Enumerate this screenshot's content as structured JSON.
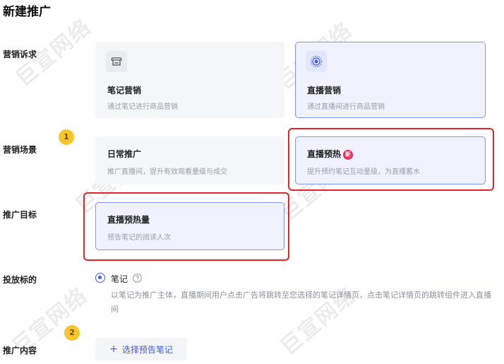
{
  "page_title": "新建推广",
  "labels": {
    "marketing_goal": "营销诉求",
    "marketing_scene": "营销场景",
    "promotion_target": "推广目标",
    "delivery_object": "投放标的",
    "promotion_content": "推广内容"
  },
  "goal_cards": [
    {
      "title": "笔记营销",
      "desc": "通过笔记进行商品营销",
      "icon": "store-icon"
    },
    {
      "title": "直播营销",
      "desc": "通过直播间进行商品营销",
      "icon": "live-icon"
    }
  ],
  "scene_cards": [
    {
      "title": "日常推广",
      "desc": "推广直播间，提升有效观看量级与成交"
    },
    {
      "title": "直播预热",
      "badge": "新",
      "desc": "提升预约笔记互动量级，为直播蓄水"
    }
  ],
  "target_card": {
    "title": "直播预热量",
    "desc": "预告笔记的阅读人次"
  },
  "delivery": {
    "option_label": "笔记",
    "description": "以笔记为推广主体，直播期间用户点击广告将跳转至您选择的笔记详情页，点击笔记详情页的跳转组件进入直播间"
  },
  "content": {
    "button_label": "选择预告笔记"
  },
  "annotations": [
    "1",
    "2"
  ],
  "watermark": "巨宣网络",
  "colors": {
    "accent": "#3b5bff",
    "highlight": "#e3242b",
    "badge": "#f7c62d",
    "new_badge": "#e8335a"
  }
}
